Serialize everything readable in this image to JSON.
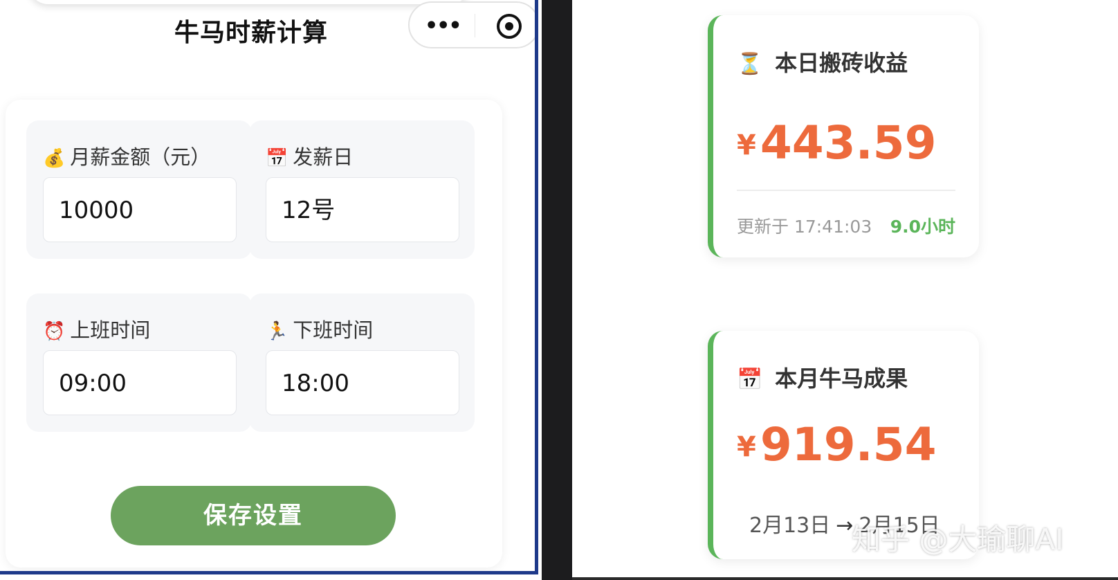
{
  "app": {
    "title": "牛马时薪计算",
    "capsule": {
      "menu_icon": "more-dots-icon",
      "close_icon": "target-circle-icon"
    }
  },
  "settings": {
    "salary": {
      "icon": "money-bag-icon",
      "emoji": "💰",
      "label": "月薪金额（元）",
      "value": "10000"
    },
    "payday": {
      "icon": "calendar-icon",
      "emoji": "📅",
      "label": "发薪日",
      "value": "12号"
    },
    "start_time": {
      "icon": "alarm-clock-icon",
      "emoji": "⏰",
      "label": "上班时间",
      "value": "09:00"
    },
    "end_time": {
      "icon": "running-person-icon",
      "emoji": "🏃",
      "label": "下班时间",
      "value": "18:00"
    },
    "save_label": "保存设置"
  },
  "today_card": {
    "icon": "hourglass-icon",
    "emoji": "⏳",
    "title": "本日搬砖收益",
    "currency": "¥",
    "amount": "443.59",
    "update_text": "更新于 17:41:03",
    "rate": "9.0小时"
  },
  "month_card": {
    "icon": "calendar-icon",
    "emoji": "📅",
    "title": "本月牛马成果",
    "currency": "¥",
    "amount": "919.54",
    "range_start": "2月13日",
    "range_arrow": "→",
    "range_end": "2月15日"
  },
  "watermark": "知乎 @大瑜聊AI",
  "colors": {
    "accent_green": "#5bb55a",
    "button_green": "#6ca35e",
    "amount_orange": "#ed6a3c"
  }
}
